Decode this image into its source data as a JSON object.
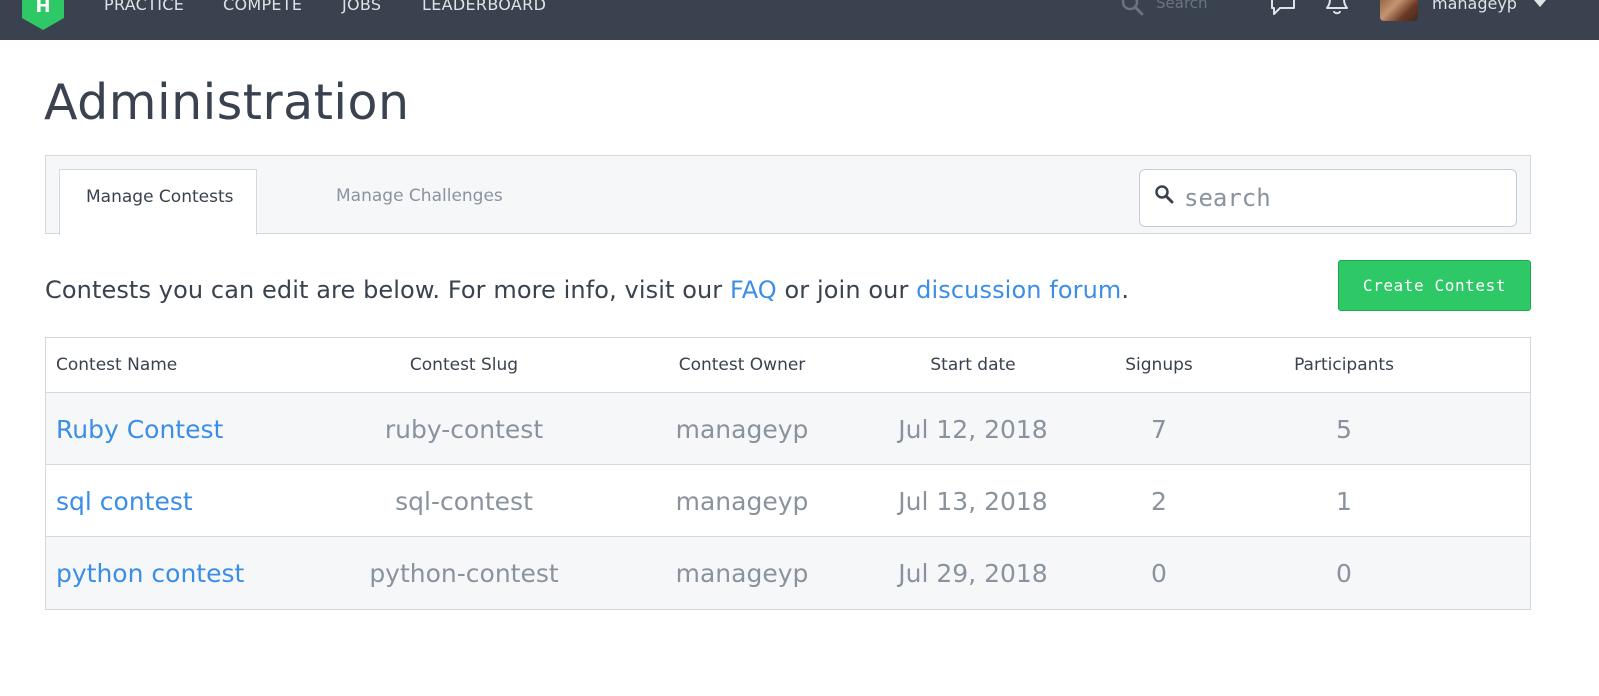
{
  "header": {
    "nav_items": [
      "PRACTICE",
      "COMPETE",
      "JOBS",
      "LEADERBOARD"
    ],
    "search_placeholder": "Search",
    "username": "manageyp",
    "logo_letter": "H"
  },
  "page": {
    "title": "Administration"
  },
  "tabs": {
    "items": [
      {
        "label": "Manage Contests",
        "active": true
      },
      {
        "label": "Manage Challenges",
        "active": false
      }
    ],
    "search_placeholder": "search"
  },
  "info": {
    "text_before": "Contests you can edit are below. For more info, visit our ",
    "faq_link": "FAQ",
    "text_middle": " or join our ",
    "forum_link": "discussion forum",
    "text_after": "."
  },
  "actions": {
    "create_contest": "Create Contest"
  },
  "table": {
    "columns": [
      "Contest Name",
      "Contest Slug",
      "Contest Owner",
      "Start date",
      "Signups",
      "Participants"
    ],
    "rows": [
      {
        "name": "Ruby Contest",
        "slug": "ruby-contest",
        "owner": "manageyp",
        "start_date": "Jul 12, 2018",
        "signups": "7",
        "participants": "5"
      },
      {
        "name": "sql contest",
        "slug": "sql-contest",
        "owner": "manageyp",
        "start_date": "Jul 13, 2018",
        "signups": "2",
        "participants": "1"
      },
      {
        "name": "python contest",
        "slug": "python-contest",
        "owner": "manageyp",
        "start_date": "Jul 29, 2018",
        "signups": "0",
        "participants": "0"
      }
    ]
  },
  "colors": {
    "topbar": "#39424e",
    "brand_green": "#2ec866",
    "link_blue": "#3b8ee6",
    "muted_text": "#8a939d"
  },
  "icons": {
    "logo": "hackerrank-logo-icon",
    "search": "search-icon",
    "messages": "chat-bubble-icon",
    "notifications": "bell-icon",
    "dropdown": "caret-down-icon"
  }
}
